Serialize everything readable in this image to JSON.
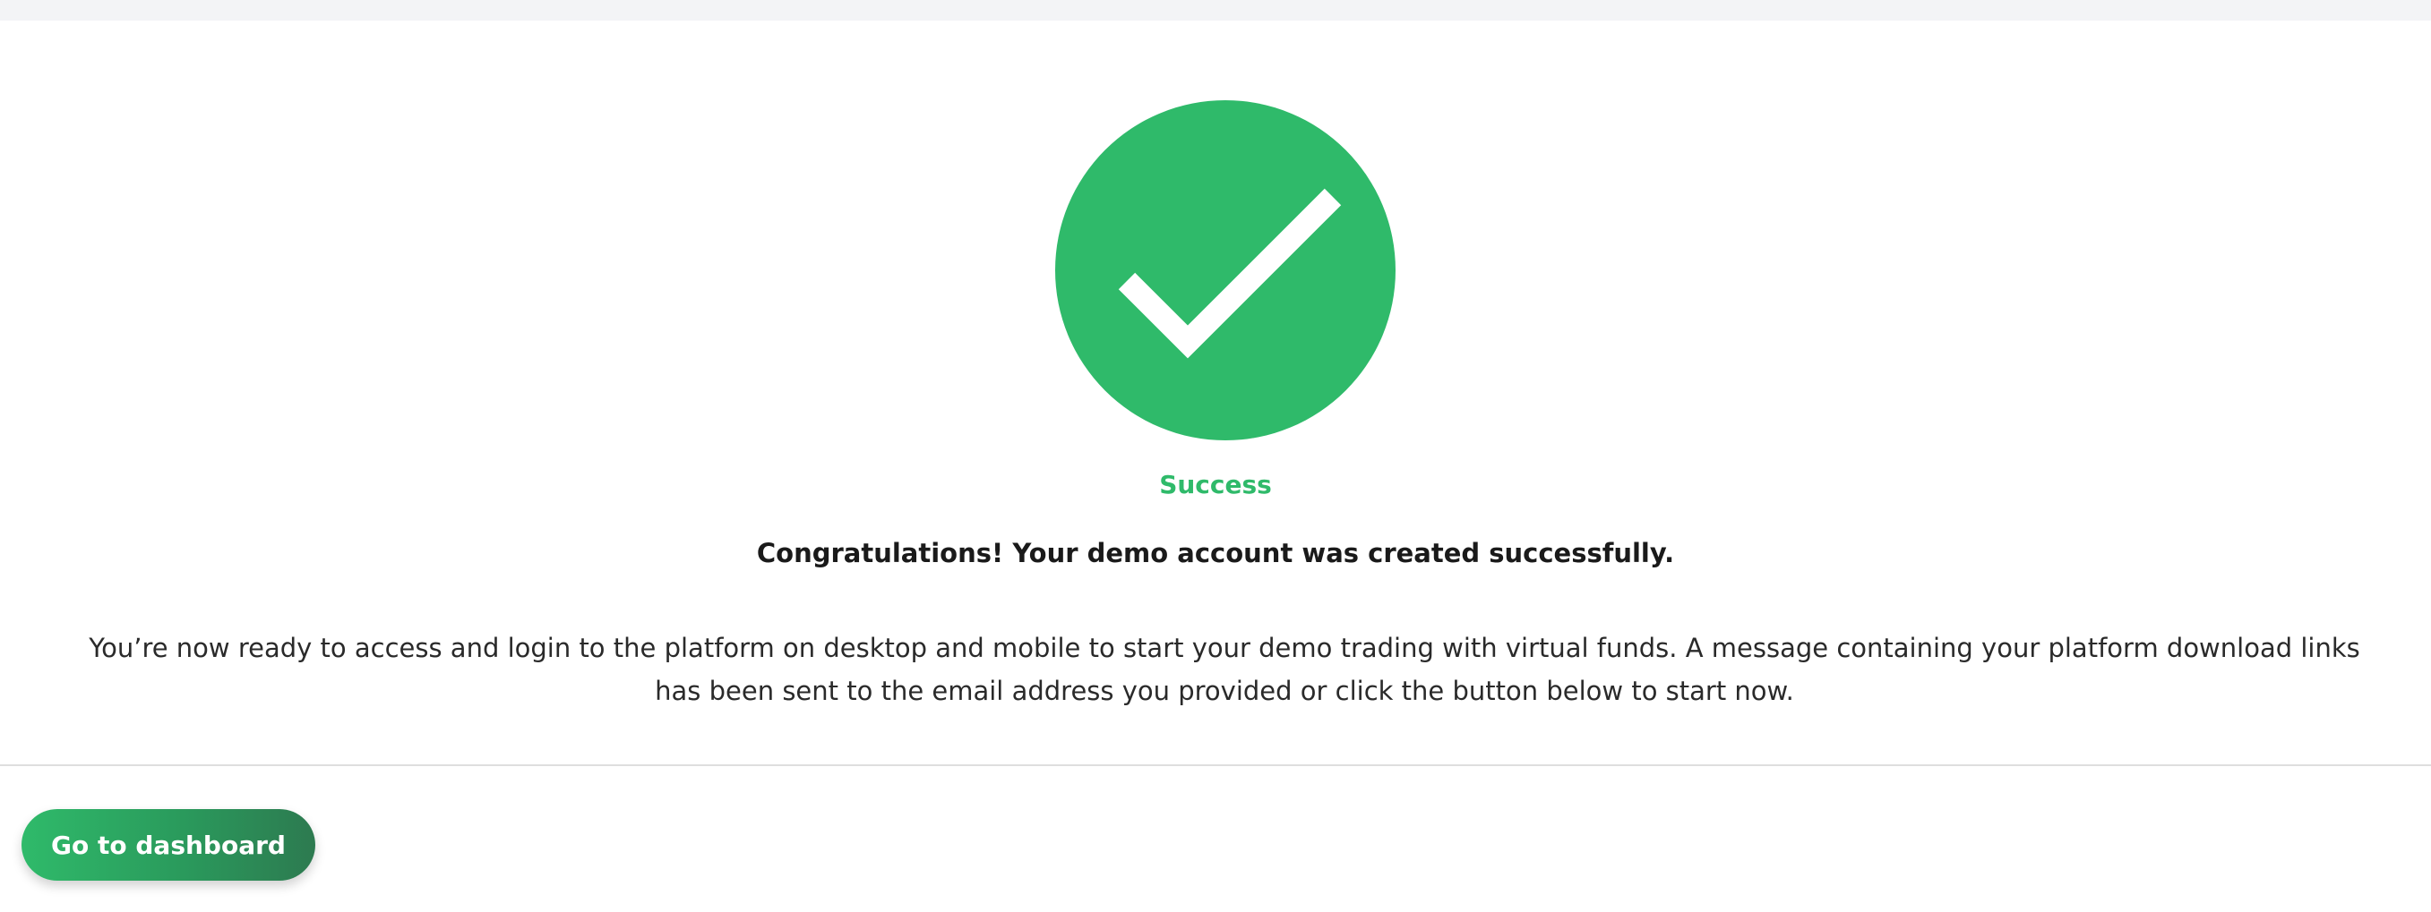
{
  "success": {
    "icon": "checkmark-circle-icon",
    "status": "Success",
    "headline": "Congratulations! Your demo account was created successfully.",
    "message": "You’re now ready to access and login to the platform on desktop and mobile to start your demo trading with virtual funds. A message containing your platform download links has been sent to the email address you provided or click the button below to start now."
  },
  "actions": {
    "dashboard_label": "Go to dashboard"
  },
  "colors": {
    "accent_green": "#2fba6a",
    "button_gradient_end": "#2d7a50",
    "divider": "#dedede",
    "top_strip": "#f3f4f6"
  }
}
